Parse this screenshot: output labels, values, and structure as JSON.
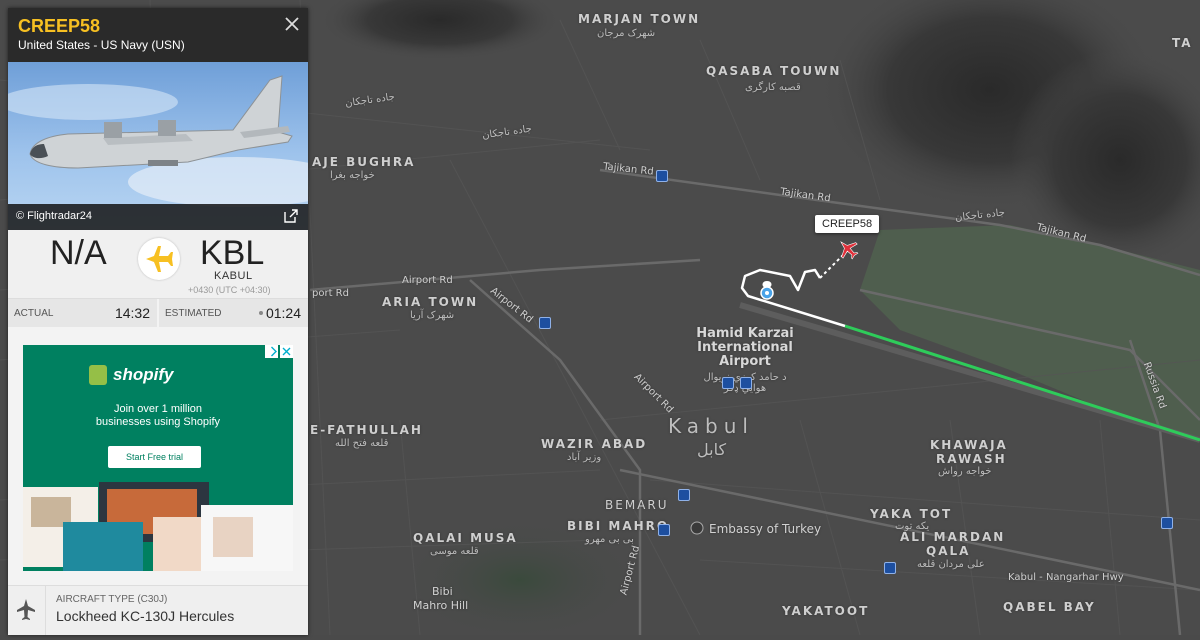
{
  "map": {
    "labels": {
      "marjan_town": "MARJAN TOWN",
      "marjan_town_ar": "شهرک مرجان",
      "qasaba_town": "QASABA TOUWN",
      "qasaba_town_ar": "قصبه کارگری",
      "jade_tajikan_1": "جاده تاجکان",
      "jade_tajikan_2": "جاده تاجکان",
      "jade_tajikan_3": "جاده تاجکان",
      "aje_bughra": "AJE BUGHRA",
      "aje_bughra_ar": "خواجه بغرا",
      "tajikan_rd_1": "Tajikan Rd",
      "tajikan_rd_2": "Tajikan Rd",
      "tajikan_rd_3": "Tajikan Rd",
      "airport_rd_1": "Airport Rd",
      "airport_rd_2": "Airport Rd",
      "airport_rd_3": "Airport Rd",
      "airport_rd_4": "Airport Rd",
      "airport_rd_5": "Airport Rd",
      "port_rd": "port Rd",
      "aria_town": "ARIA TOWN",
      "aria_town_ar": "شهرک آریا",
      "hamid_karzai": "Hamid Karzai",
      "international": "International",
      "airport": "Airport",
      "airport_ar": "د حامد کرزي نړیوال هوایي ډګر",
      "fathullah": "E-FATHULLAH",
      "fathullah_ar": "قلعه فتح الله",
      "wazir_abad": "WAZIR ABAD",
      "wazir_abad_ar": "وزیر آباد",
      "kabul": "Kabul",
      "kabul_ar": "کابل",
      "khawaja_rawash": "KHAWAJA",
      "khawaja_rawash_2": "RAWASH",
      "khawaja_rawash_ar": "خواجه رواش",
      "bemaru": "BEMARU",
      "bibi_mahro": "BIBI MAHRO",
      "bibi_mahro_ar": "بی بی مهرو",
      "embassy": "Embassy of Turkey",
      "yaka_tot": "YAKA TOT",
      "yaka_tot_ar": "یکه توت",
      "ali_mardan": "ALI MARDAN",
      "qala": "QALA",
      "ali_mardan_ar": "علی مردان قلعه",
      "qalai_musa": "QALAI MUSA",
      "qalai_musa_ar": "قلعه موسی",
      "bibi_hill_1": "Bibi",
      "bibi_hill_2": "Mahro Hill",
      "kabul_nangarhar": "Kabul - Nangarhar Hwy",
      "yakatoot": "YAKATOOT",
      "qabel_bay": "QABEL BAY",
      "russia_rd": "Russia Rd",
      "ta": "TA"
    },
    "flight_tag": "CREEP58",
    "colors": {
      "track_green": "#2ecc5a",
      "track_white": "#ffffff",
      "aircraft": "#e0303a"
    }
  },
  "panel": {
    "callsign": "CREEP58",
    "airline": "United States - US Navy (USN)",
    "close_icon": "close-icon",
    "photo_credit": "© Flightradar24",
    "origin_code": "N/A",
    "dest_code": "KBL",
    "dest_city": "KABUL",
    "dest_tz": "+0430 (UTC +04:30)",
    "actual_label": "ACTUAL",
    "actual_time": "14:32",
    "estimated_label": "ESTIMATED",
    "estimated_time": "01:24",
    "aircraft_type_label": "AIRCRAFT TYPE  (C30J)",
    "aircraft_type_value": "Lockheed KC-130J Hercules",
    "accent": "#f7c022"
  },
  "ad": {
    "brand": "shopify",
    "headline_1": "Join over 1 million",
    "headline_2": "businesses using Shopify",
    "cta": "Start Free trial",
    "bg": "#008060"
  }
}
